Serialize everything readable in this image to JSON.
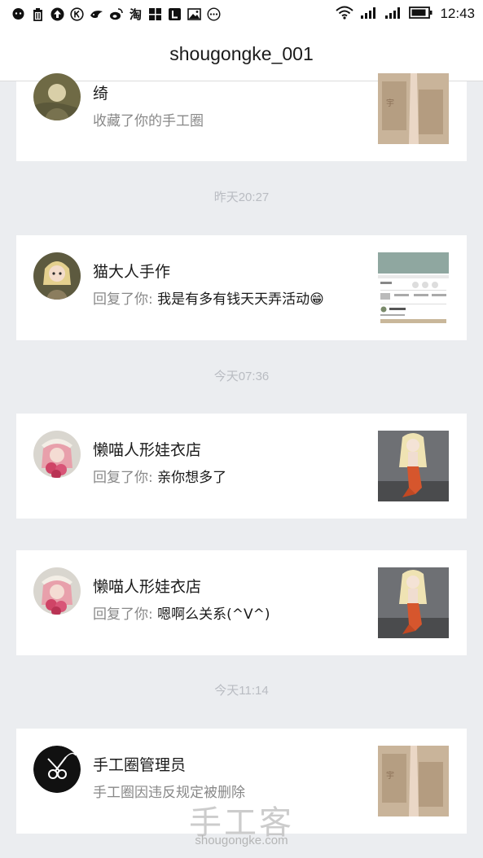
{
  "status_bar": {
    "time": "12:43",
    "left_icons": [
      "wechat-icon",
      "trash-icon",
      "upload-icon",
      "k-icon",
      "bird-icon",
      "weibo-icon",
      "taobao-icon",
      "apps-icon",
      "l-icon",
      "image-icon",
      "more-icon"
    ],
    "taobao_label": "淘"
  },
  "header": {
    "title": "shougongke_001"
  },
  "notifications": [
    {
      "name": "绮",
      "action": "收藏了你的手工圈",
      "reply": ""
    },
    {
      "name": "猫大人手作",
      "action": "回复了你: ",
      "reply": "我是有多有钱天天弄活动😁"
    },
    {
      "name": "懒喵人形娃衣店",
      "action": "回复了你: ",
      "reply": "亲你想多了"
    },
    {
      "name": "懒喵人形娃衣店",
      "action": "回复了你: ",
      "reply": "嗯啊么关系(^V^)"
    },
    {
      "name": "手工圈管理员",
      "action": "手工圈因违反规定被删除",
      "reply": ""
    }
  ],
  "time_separators": [
    "昨天20:27",
    "今天07:36",
    "今天11:14"
  ],
  "watermark": {
    "cn": "手工客",
    "en": "shougongke.com"
  },
  "colors": {
    "background": "#ebedf0",
    "card": "#ffffff",
    "separator_text": "#b9bcc2",
    "secondary_text": "#888888"
  }
}
